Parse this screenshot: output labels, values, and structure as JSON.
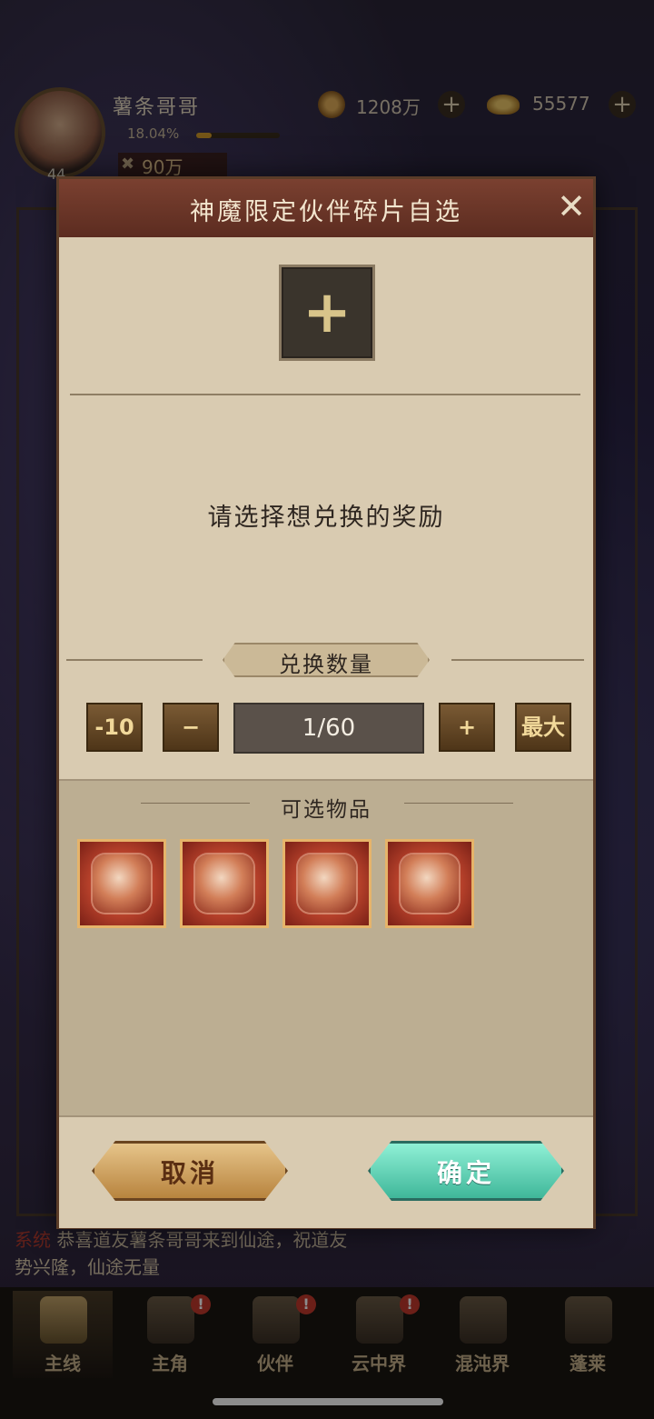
{
  "player": {
    "name": "薯条哥哥",
    "level": "44",
    "exp_percent": "18.04%",
    "exp_fraction": 0.1804,
    "power": "90万",
    "coins": "1208万",
    "ingots": "55577"
  },
  "system_message": {
    "tag": "系统",
    "line1": "恭喜道友薯条哥哥来到仙途，祝道友",
    "line2": "势兴隆，仙途无量"
  },
  "modal": {
    "title": "神魔限定伙伴碎片自选",
    "close_icon": "close-icon",
    "slot_icon": "plus-icon",
    "prompt": "请选择想兑换的奖励",
    "quantity_label": "兑换数量",
    "minus10_label": "-10",
    "minus_label": "−",
    "quantity_value": "1/60",
    "plus_label": "+",
    "max_label": "最大",
    "items_title": "可选物品",
    "items": [
      {
        "name": "companion-shard-1"
      },
      {
        "name": "companion-shard-2"
      },
      {
        "name": "companion-shard-3"
      },
      {
        "name": "companion-shard-4"
      }
    ],
    "cancel_label": "取消",
    "confirm_label": "确定"
  },
  "nav": [
    {
      "label": "主线",
      "active": true,
      "badge": ""
    },
    {
      "label": "主角",
      "active": false,
      "badge": "!"
    },
    {
      "label": "伙伴",
      "active": false,
      "badge": "!"
    },
    {
      "label": "云中界",
      "active": false,
      "badge": "!"
    },
    {
      "label": "混沌界",
      "active": false,
      "badge": ""
    },
    {
      "label": "蓬莱",
      "active": false,
      "badge": ""
    }
  ],
  "colors": {
    "modal_bg": "#d9cbb1",
    "header_bg": "#6b3426",
    "cancel_button": "#d6a65c",
    "confirm_button": "#5fd4b6",
    "item_frame": "#e6b46a"
  }
}
